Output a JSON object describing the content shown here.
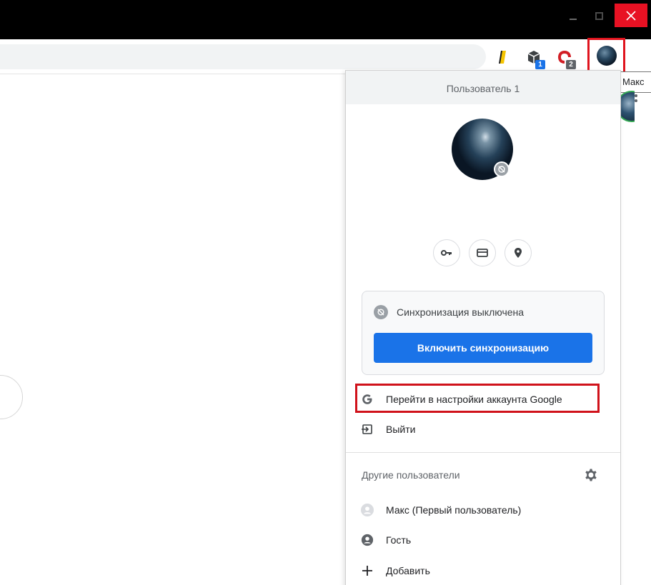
{
  "window": {
    "close_icon": "close-icon",
    "minimize_icon": "minimize-icon",
    "maximize_icon": "maximize-icon"
  },
  "toolbar": {
    "extensions": [
      {
        "icon": "yandex-bookmark-icon",
        "badge": ""
      },
      {
        "icon": "extension-box-icon",
        "badge": "1"
      },
      {
        "icon": "opera-vpn-icon",
        "badge": "2"
      }
    ],
    "profile_icon": "profile-avatar-icon",
    "menu_icon": "more-vert-icon"
  },
  "tooltip": {
    "text": "Макс"
  },
  "profile_menu": {
    "header": "Пользователь 1",
    "quick_actions": [
      {
        "icon": "key-icon",
        "name": "passwords"
      },
      {
        "icon": "card-icon",
        "name": "payment-methods"
      },
      {
        "icon": "location-pin-icon",
        "name": "addresses"
      }
    ],
    "sync_status": "Синхронизация выключена",
    "sync_button": "Включить синхронизацию",
    "google_account": "Перейти в настройки аккаунта Google",
    "sign_out": "Выйти",
    "other_users_label": "Другие пользователи",
    "other_users": [
      {
        "label": "Макс (Первый пользователь)",
        "icon": "person-avatar-icon"
      },
      {
        "label": "Гость",
        "icon": "guest-icon"
      },
      {
        "label": "Добавить",
        "icon": "plus-icon"
      }
    ]
  },
  "colors": {
    "accent": "#1a73e8",
    "highlight": "#d0121b",
    "close": "#e81123"
  }
}
